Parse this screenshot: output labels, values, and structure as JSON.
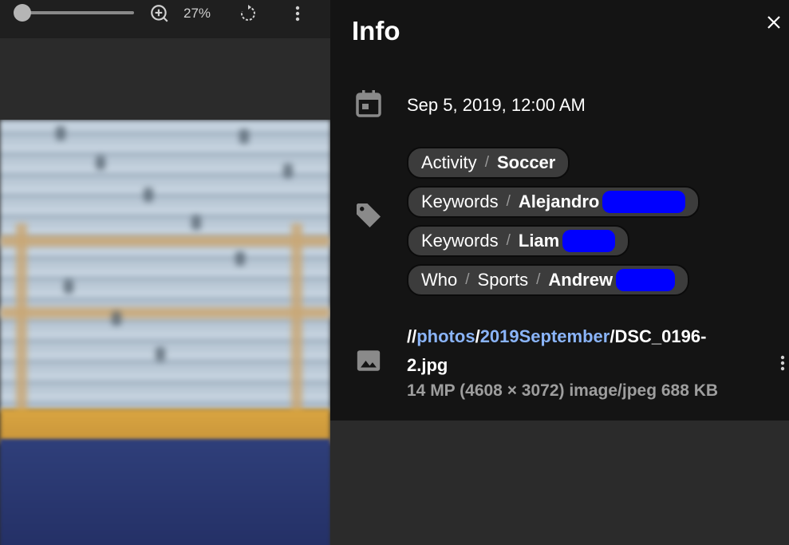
{
  "toolbar": {
    "zoom_level": "27%",
    "icons": [
      "zoom-in-icon",
      "rotate-icon",
      "more-vert-icon"
    ]
  },
  "info": {
    "title": "Info",
    "date": "Sep 5, 2019, 12:00 AM",
    "tags": [
      {
        "category": "Activity",
        "value": "Soccer",
        "redacted": false
      },
      {
        "category": "Keywords",
        "value": "Alejandro",
        "redacted": true
      },
      {
        "category": "Keywords",
        "value": "Liam",
        "redacted": true
      },
      {
        "category": "Who",
        "sub": "Sports",
        "value": "Andrew",
        "redacted": true
      }
    ],
    "separator": "/",
    "path": {
      "prefix": "//",
      "folder1": "photos",
      "sep": "/",
      "folder2": "2019September",
      "filename": "/DSC_0196-2.jpg"
    },
    "meta": "14 MP (4608 × 3072) image/jpeg 688 KB"
  },
  "colors": {
    "panel_bg": "#141414",
    "chip_bg": "#3c3c3c",
    "link": "#8ab4f8",
    "redaction": "#0000ff"
  }
}
